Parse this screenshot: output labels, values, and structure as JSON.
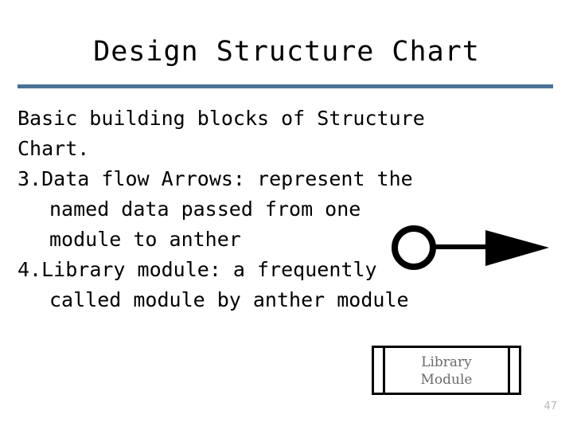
{
  "slide": {
    "title": "Design Structure Chart",
    "page_number": "47",
    "divider_color": "#4a7296",
    "background_color": "#ffffff",
    "text_color": "#000000"
  },
  "body": {
    "intro": {
      "line1": "Basic building blocks of Structure",
      "line2": "Chart."
    },
    "items": [
      {
        "marker": "3.",
        "line1": "Data flow Arrows: represent the",
        "line2": "named data passed from one",
        "line3": "module to anther"
      },
      {
        "marker": "4.",
        "line1": "Library module: a frequently",
        "line2": "called module by anther module"
      }
    ]
  },
  "figures": {
    "data_flow_arrow": {
      "name": "data-flow-arrow",
      "circle_fill": "#ffffff",
      "stroke_color": "#000000"
    },
    "library_module": {
      "name": "library-module-symbol",
      "label_line1": "Library",
      "label_line2": "Module",
      "label_color": "#6b6b6b",
      "border_color": "#000000"
    }
  }
}
